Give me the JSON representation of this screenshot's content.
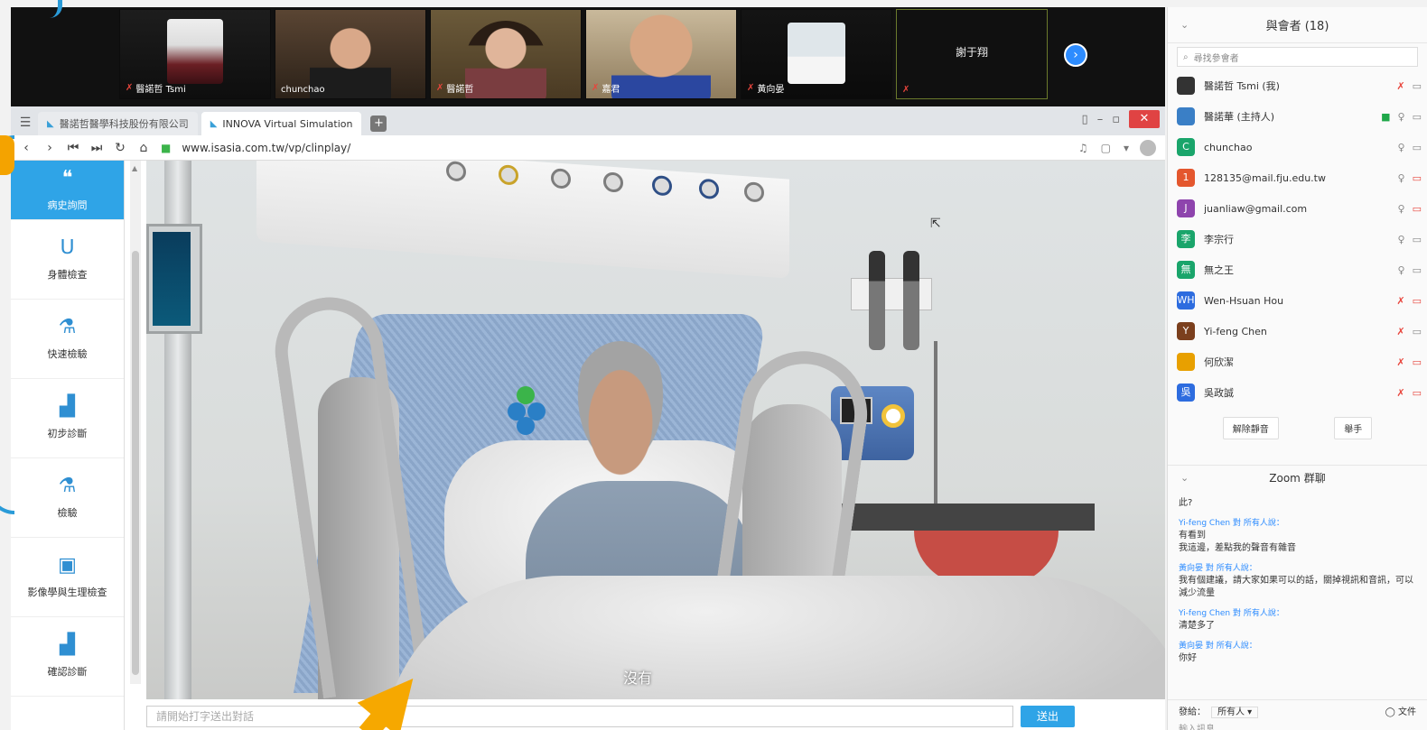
{
  "video_strip": {
    "tiles": [
      {
        "name": "醫諾哲 Tsmi"
      },
      {
        "name": "chunchao"
      },
      {
        "name": "醫諾哲"
      },
      {
        "name": "嘉君"
      },
      {
        "name": "黃向晏"
      },
      {
        "name": "",
        "center": "謝于翔"
      }
    ],
    "next_icon": "chevron-right-icon"
  },
  "browser": {
    "tabs": [
      {
        "label": "醫諾哲醫學科技股份有限公司"
      },
      {
        "label": "INNOVA Virtual Simulation"
      }
    ],
    "url": "www.isasia.com.tw/vp/clinplay/"
  },
  "sim_nav": {
    "items": [
      {
        "label": "病史詢問",
        "icon": "chat-icon"
      },
      {
        "label": "身體檢查",
        "icon": "stethoscope-icon"
      },
      {
        "label": "快速檢驗",
        "icon": "flask-icon"
      },
      {
        "label": "初步診斷",
        "icon": "bar-chart-icon"
      },
      {
        "label": "檢驗",
        "icon": "flask-icon"
      },
      {
        "label": "影像學與生理檢查",
        "icon": "xray-file-icon"
      },
      {
        "label": "確認診斷",
        "icon": "bar-chart-icon"
      }
    ]
  },
  "scene": {
    "subtitle": "沒有"
  },
  "input_row": {
    "placeholder": "請開始打字送出對話",
    "send_label": "送出"
  },
  "participants": {
    "title": "與會者 (18)",
    "search_placeholder": "尋找參會者",
    "list": [
      {
        "initial": "",
        "name": "醫諾哲 Tsmi (我)",
        "color": "#333333",
        "mic": "muted",
        "video": "off"
      },
      {
        "initial": "",
        "name": "醫諾華 (主持人)",
        "color": "#3a7fc6",
        "mic": "on",
        "video": "on"
      },
      {
        "initial": "C",
        "name": "chunchao",
        "color": "#1aa56b",
        "mic": "on",
        "video": "off"
      },
      {
        "initial": "1",
        "name": "128135@mail.fju.edu.tw",
        "color": "#e4572e",
        "mic": "on",
        "video": "muted"
      },
      {
        "initial": "J",
        "name": "juanliaw@gmail.com",
        "color": "#8e44ad",
        "mic": "on",
        "video": "muted"
      },
      {
        "initial": "李",
        "name": "李宗行",
        "color": "#1aa56b",
        "mic": "on",
        "video": "off"
      },
      {
        "initial": "無",
        "name": "無之王",
        "color": "#1aa56b",
        "mic": "on",
        "video": "off"
      },
      {
        "initial": "WH",
        "name": "Wen-Hsuan Hou",
        "color": "#2d6cdf",
        "mic": "muted",
        "video": "muted"
      },
      {
        "initial": "Y",
        "name": "Yi-feng Chen",
        "color": "#7b3f1d",
        "mic": "muted",
        "video": "off"
      },
      {
        "initial": "",
        "name": "何欣潔",
        "color": "#e8a000",
        "mic": "muted",
        "video": "muted"
      },
      {
        "initial": "吳",
        "name": "吳政誠",
        "color": "#2d6cdf",
        "mic": "muted",
        "video": "muted"
      }
    ],
    "actions": [
      "解除靜音",
      "舉手"
    ]
  },
  "chat": {
    "title": "Zoom 群聊",
    "messages": [
      {
        "from": "",
        "text": "此?"
      },
      {
        "from": "Yi-feng Chen 對 所有人說：",
        "text": "有看到\n我這邊，差點我的聲音有雜音"
      },
      {
        "from": "黃向晏 對 所有人說：",
        "text": "我有個建議，請大家如果可以的話，關掉視訊和音訊，可以減少流量"
      },
      {
        "from": "Yi-feng Chen 對 所有人說：",
        "text": "清楚多了"
      },
      {
        "from": "黃向晏 對 所有人說：",
        "text": "你好"
      }
    ],
    "to_label": "發給：",
    "to_value": "所有人 ▾",
    "file_label": "文件",
    "input_placeholder": "輸入訊息"
  },
  "colors": {
    "accent": "#2fa4e7",
    "zoom_blue": "#2d8cff",
    "annotation_yellow": "#f6a800"
  }
}
